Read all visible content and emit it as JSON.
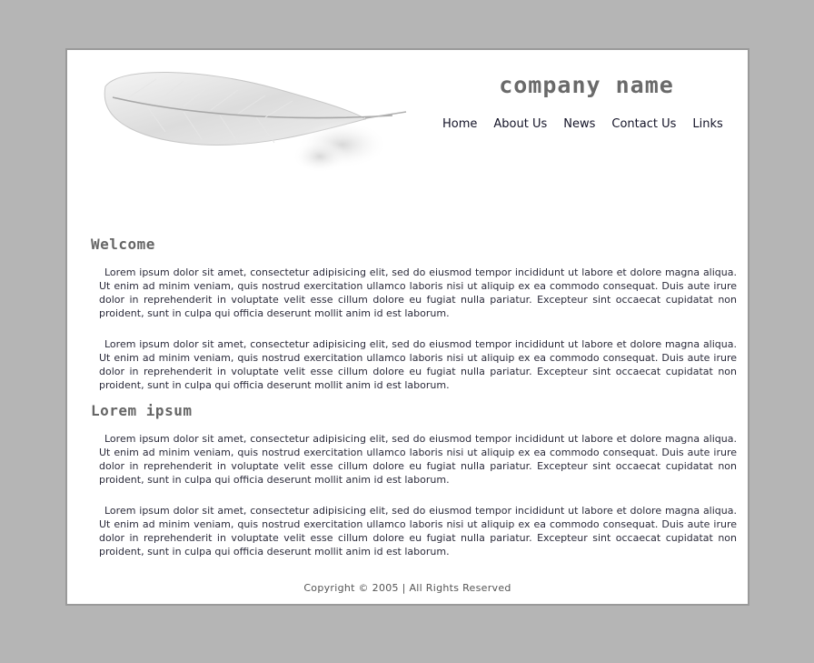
{
  "header": {
    "company_name": "company name",
    "logo_icon": "feather-icon"
  },
  "nav": {
    "items": [
      {
        "label": "Home"
      },
      {
        "label": "About Us"
      },
      {
        "label": "News"
      },
      {
        "label": "Contact Us"
      },
      {
        "label": "Links"
      }
    ]
  },
  "sections": [
    {
      "title": "Welcome",
      "paragraphs": [
        "Lorem ipsum dolor sit amet, consectetur adipisicing elit, sed do eiusmod tempor incididunt ut labore et dolore magna aliqua. Ut enim ad minim veniam, quis nostrud exercitation ullamco laboris nisi ut aliquip ex ea commodo consequat. Duis aute irure dolor in reprehenderit in voluptate velit esse cillum dolore eu fugiat nulla pariatur. Excepteur sint occaecat cupidatat non proident, sunt in culpa qui officia deserunt mollit anim id est laborum.",
        "Lorem ipsum dolor sit amet, consectetur adipisicing elit, sed do eiusmod tempor incididunt ut labore et dolore magna aliqua. Ut enim ad minim veniam, quis nostrud exercitation ullamco laboris nisi ut aliquip ex ea commodo consequat. Duis aute irure dolor in reprehenderit in voluptate velit esse cillum dolore eu fugiat nulla pariatur. Excepteur sint occaecat cupidatat non proident, sunt in culpa qui officia deserunt mollit anim id est laborum."
      ]
    },
    {
      "title": "Lorem ipsum",
      "paragraphs": [
        "Lorem ipsum dolor sit amet, consectetur adipisicing elit, sed do eiusmod tempor incididunt ut labore et dolore magna aliqua. Ut enim ad minim veniam, quis nostrud exercitation ullamco laboris nisi ut aliquip ex ea commodo consequat. Duis aute irure dolor in reprehenderit in voluptate velit esse cillum dolore eu fugiat nulla pariatur. Excepteur sint occaecat cupidatat non proident, sunt in culpa qui officia deserunt mollit anim id est laborum.",
        "Lorem ipsum dolor sit amet, consectetur adipisicing elit, sed do eiusmod tempor incididunt ut labore et dolore magna aliqua. Ut enim ad minim veniam, quis nostrud exercitation ullamco laboris nisi ut aliquip ex ea commodo consequat. Duis aute irure dolor in reprehenderit in voluptate velit esse cillum dolore eu fugiat nulla pariatur. Excepteur sint occaecat cupidatat non proident, sunt in culpa qui officia deserunt mollit anim id est laborum."
      ]
    }
  ],
  "footer": {
    "copyright": "Copyright © 2005 | All Rights Reserved"
  },
  "colors": {
    "page_background": "#b5b5b5",
    "content_background": "#ffffff",
    "frame_border": "#9a9a9a",
    "heading": "#666666",
    "body_text": "#2a2a3a",
    "nav_text": "#141428"
  }
}
